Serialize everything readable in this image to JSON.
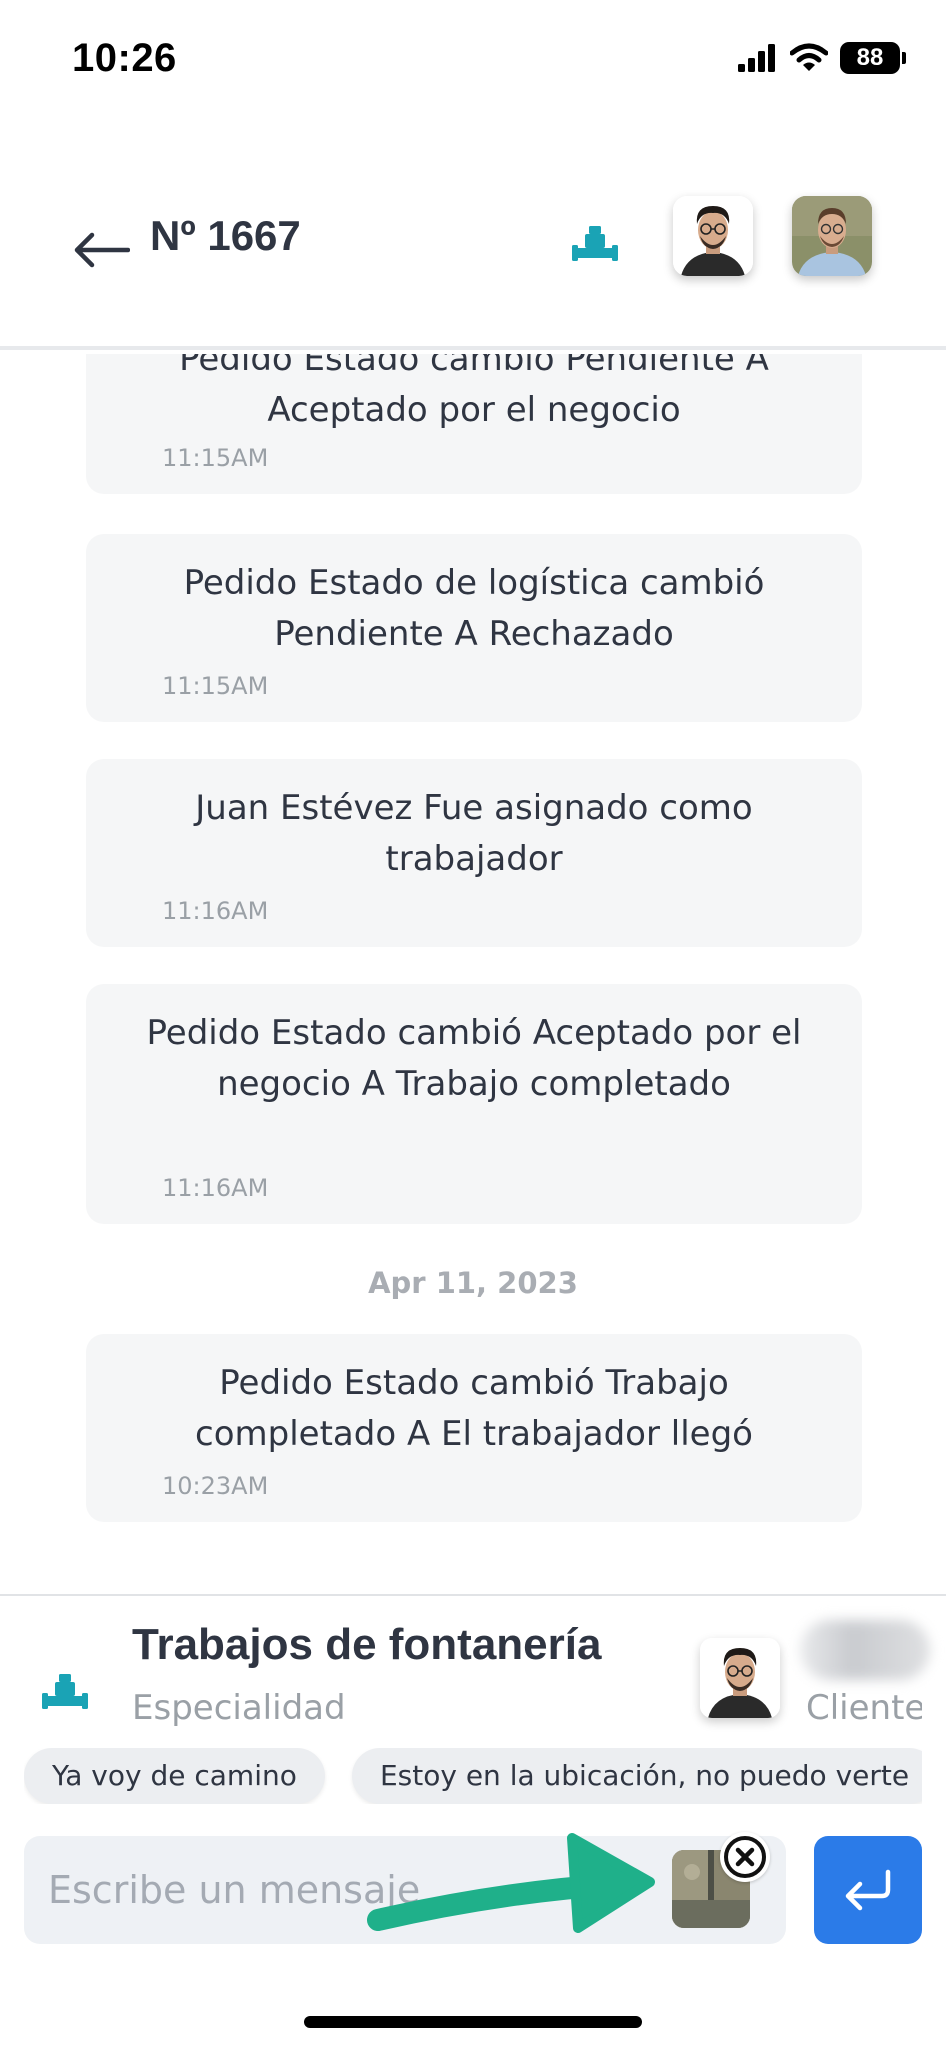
{
  "status_bar": {
    "time": "10:26",
    "battery": "88",
    "icons": [
      "cellular-signal-icon",
      "wifi-icon",
      "battery-icon"
    ]
  },
  "header": {
    "title": "Nº 1667",
    "icons": [
      "back-arrow-icon",
      "plumbing-icon"
    ],
    "avatars": [
      "worker-avatar",
      "client-avatar"
    ]
  },
  "messages": [
    {
      "text": "Pedido Estado cambió Pendiente A Aceptado por el negocio",
      "time": "11:15AM"
    },
    {
      "text": "Pedido Estado de logística cambió Pendiente A Rechazado",
      "time": "11:15AM"
    },
    {
      "text": "Juan Estévez  Fue asignado como trabajador",
      "time": "11:16AM"
    },
    {
      "text": "Pedido Estado cambió Aceptado por el negocio A Trabajo completado",
      "time": "11:16AM"
    },
    {
      "text": "Pedido Estado cambió Trabajo completado A El trabajador llegó",
      "time": "10:23AM"
    }
  ],
  "date_separator": "Apr 11, 2023",
  "bottom_panel": {
    "specialty_title": "Trabajos de fontanería",
    "specialty_label": "Especialidad",
    "client_label": "Cliente",
    "quick_replies": [
      "Ya voy de camino",
      "Estoy en la ubicación, no puedo verte"
    ],
    "input_placeholder": "Escribe un mensaje",
    "colors": {
      "accent_teal": "#1aa3b5",
      "send_blue": "#2b7be8",
      "annotation_green": "#1fb08a"
    }
  }
}
